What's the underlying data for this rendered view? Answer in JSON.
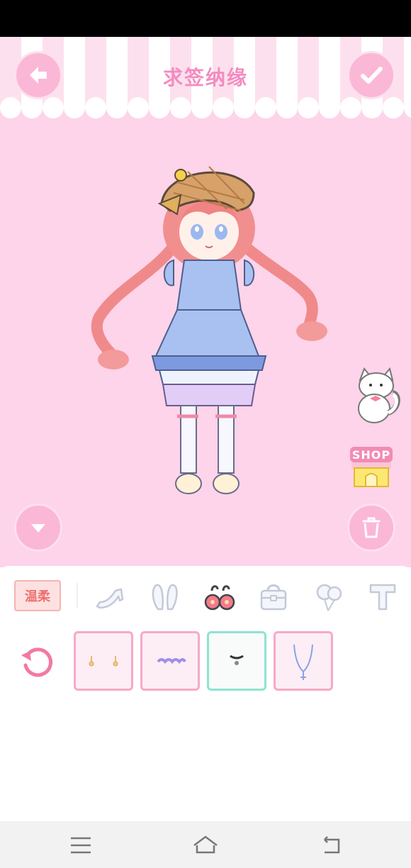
{
  "header": {
    "title": "求签纳缘"
  },
  "panel": {
    "style_tag": "温柔"
  },
  "shop": {
    "label": "SHOP"
  },
  "colors": {
    "stage_bg": "#fdd4ea",
    "accent": "#f48cc0",
    "button": "#fbb7d6",
    "selected_border": "#8fe3d0"
  },
  "tabs": [
    {
      "icon": "shoe-icon"
    },
    {
      "icon": "bunny-ears-icon"
    },
    {
      "icon": "earring-icon",
      "active": true
    },
    {
      "icon": "bag-icon"
    },
    {
      "icon": "balloon-icon"
    },
    {
      "icon": "text-icon"
    }
  ],
  "items": [
    {
      "icon": "earrings-item-icon"
    },
    {
      "icon": "headband-item-icon"
    },
    {
      "icon": "choker-item-icon",
      "selected": true
    },
    {
      "icon": "necklace-item-icon"
    }
  ]
}
